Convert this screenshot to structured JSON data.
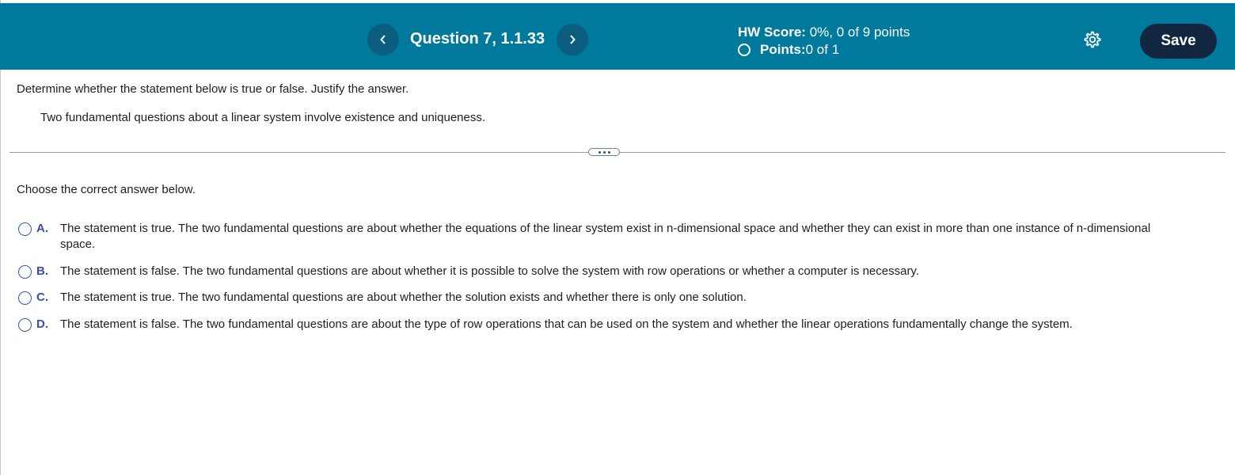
{
  "header": {
    "question_title": "Question 7, 1.1.33",
    "hw_score_label": "HW Score:",
    "hw_score_value": " 0%, 0 of 9 points",
    "points_label": "Points:",
    "points_value": " 0 of 1",
    "save_label": "Save",
    "prev_icon": "chevron-left-icon",
    "next_icon": "chevron-right-icon",
    "settings_icon": "gear-icon"
  },
  "question": {
    "instruction": "Determine whether the statement below is true or false. Justify the answer.",
    "statement": "Two fundamental questions about a linear system involve existence and uniqueness.",
    "choose_prompt": "Choose the correct answer below."
  },
  "options": [
    {
      "letter": "A.",
      "text": "The statement is true. The two fundamental questions are about whether the equations of the linear system exist in n-dimensional space and whether they can exist in more than one instance of n-dimensional space."
    },
    {
      "letter": "B.",
      "text": "The statement is false. The two fundamental questions are about whether it is possible to solve the system with row operations or whether a computer is necessary."
    },
    {
      "letter": "C.",
      "text": "The statement is true. The two fundamental questions are about whether the solution exists and whether there is only one solution."
    },
    {
      "letter": "D.",
      "text": "The statement is false. The two fundamental questions are about the type of row operations that can be used on the system and whether the linear operations fundamentally change the system."
    }
  ],
  "colors": {
    "header_bg": "#007a9c",
    "nav_button_bg": "#0b5e80",
    "save_button_bg": "#13263f",
    "option_letter": "#3a4ea8",
    "radio_border": "#2a5db0"
  }
}
